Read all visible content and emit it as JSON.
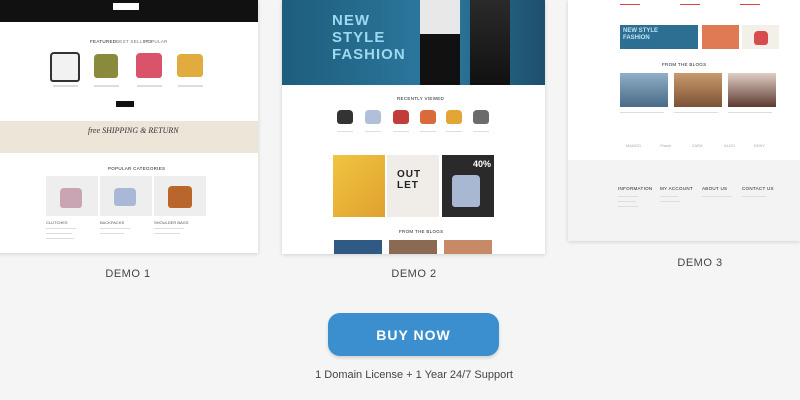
{
  "demos": [
    {
      "label": "DEMO 1",
      "preview": {
        "tabs": [
          "FEATURED",
          "BEST SELLERS",
          "POPULAR"
        ],
        "banner": "free SHIPPING & RETURN",
        "categories_title": "POPULAR CATEGORIES",
        "category_labels": [
          "CLUTCHES",
          "BACKPACKS",
          "SHOULDER BAGS"
        ]
      }
    },
    {
      "label": "DEMO 2",
      "preview": {
        "hero_text": "NEW\nSTYLE\nFASHION",
        "section_title": "RECENTLY VIEWED",
        "outlet_text": "OUT\nLET",
        "sale_text": "40%",
        "blog_title": "FROM THE BLOGS"
      }
    },
    {
      "label": "DEMO 3",
      "preview": {
        "banner_text": "NEW STYLE FASHION",
        "blog_title": "FROM THE BLOGS",
        "brands": [
          "MANGO",
          "Prada",
          "ZARA",
          "ALDO",
          "DKNY"
        ],
        "footer_cols": [
          "INFORMATION",
          "MY ACCOUNT",
          "ABOUT US",
          "CONTACT US"
        ]
      }
    }
  ],
  "cta": {
    "buy_label": "BUY NOW",
    "license_text": "1 Domain License + 1 Year 24/7 Support"
  },
  "colors": {
    "button": "#3b8fcf",
    "background": "#f5f5f5",
    "hero": "#2c7aa0"
  }
}
